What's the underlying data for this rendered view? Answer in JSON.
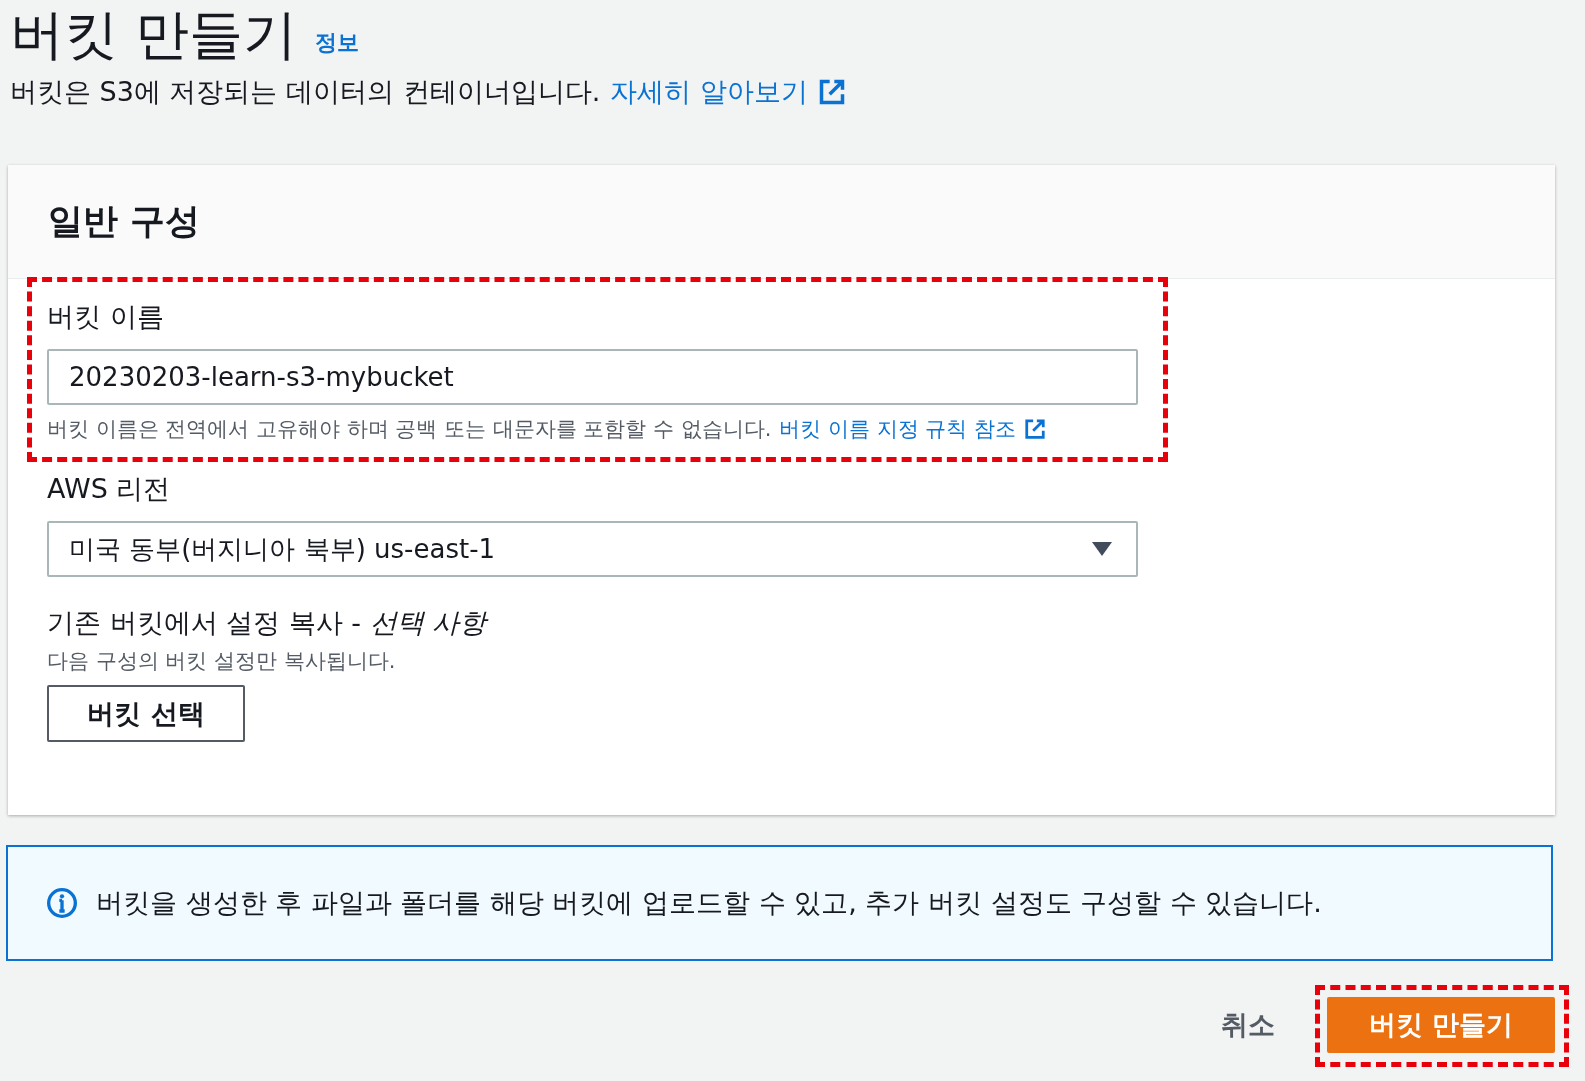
{
  "header": {
    "title": "버킷 만들기",
    "info_link": "정보",
    "description": "버킷은 S3에 저장되는 데이터의 컨테이너입니다.",
    "learn_more": "자세히 알아보기"
  },
  "general_config": {
    "title": "일반 구성",
    "bucket_name": {
      "label": "버킷 이름",
      "value": "20230203-learn-s3-mybucket",
      "hint": "버킷 이름은 전역에서 고유해야 하며 공백 또는 대문자를 포함할 수 없습니다.",
      "rules_link": "버킷 이름 지정 규칙 참조"
    },
    "region": {
      "label": "AWS 리전",
      "value": "미국 동부(버지니아 북부) us-east-1"
    },
    "copy_settings": {
      "label": "기존 버킷에서 설정 복사 - *선택 사항*",
      "description": "다음 구성의 버킷 설정만 복사됩니다.",
      "button": "버킷 선택"
    }
  },
  "info_alert": {
    "text": "버킷을 생성한 후 파일과 폴더를 해당 버킷에 업로드할 수 있고, 추가 버킷 설정도 구성할 수 있습니다."
  },
  "footer": {
    "cancel": "취소",
    "create": "버킷 만들기"
  }
}
